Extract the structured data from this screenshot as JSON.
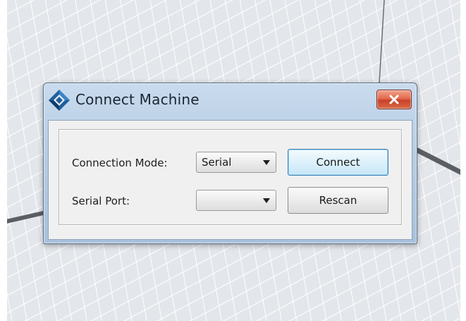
{
  "dialog": {
    "title": "Connect Machine",
    "icon": "diamond-logo-icon",
    "close_icon": "close-x-icon"
  },
  "form": {
    "connection_mode_label": "Connection Mode:",
    "connection_mode_value": "Serial",
    "serial_port_label": "Serial Port:",
    "serial_port_value": ""
  },
  "buttons": {
    "connect_label": "Connect",
    "rescan_label": "Rescan"
  },
  "colors": {
    "close_button": "#d8553a",
    "default_button_border": "#3c7fb1",
    "titlebar": "#b6cce3"
  }
}
